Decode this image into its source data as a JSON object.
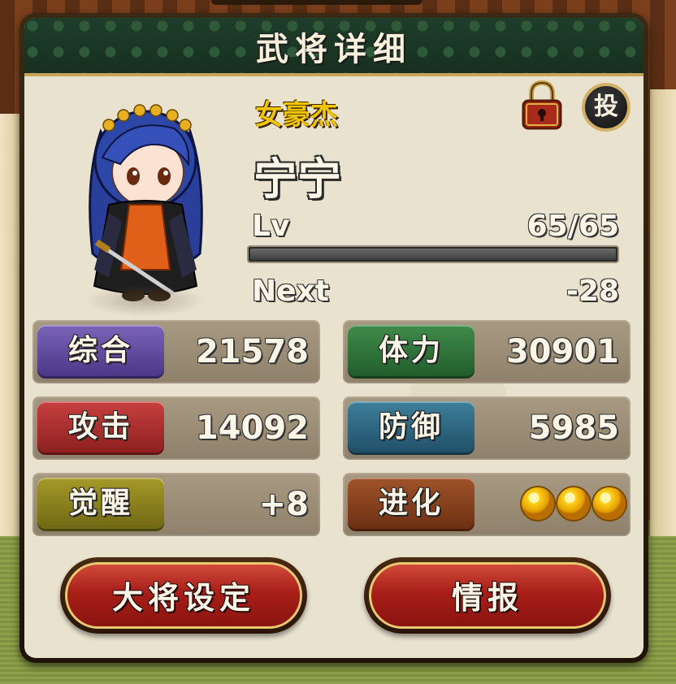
{
  "window": {
    "title": "武将详细"
  },
  "character": {
    "rarity": "女豪杰",
    "name": "宁宁",
    "level_label": "Lv",
    "level_value": "65/65",
    "exp_progress": 1.0,
    "next_label": "Next",
    "next_value": "-28"
  },
  "controls": {
    "throw_label": "投"
  },
  "stats": [
    {
      "label": "综合",
      "value": "21578",
      "color": "#5a45a0"
    },
    {
      "label": "体力",
      "value": "30901",
      "color": "#2e7a3a"
    },
    {
      "label": "攻击",
      "value": "14092",
      "color": "#a82a2a"
    },
    {
      "label": "防御",
      "value": "5985",
      "color": "#2e6a86"
    },
    {
      "label": "觉醒",
      "value": "+8",
      "color": "#8a8020"
    },
    {
      "label": "进化",
      "value": "",
      "evolution_stars": 3,
      "color": "#8a4020"
    }
  ],
  "buttons": {
    "set_leader": "大将设定",
    "info": "情报"
  },
  "icons": {
    "lock": "lock-icon",
    "evolution": "gold-coin-icon"
  }
}
